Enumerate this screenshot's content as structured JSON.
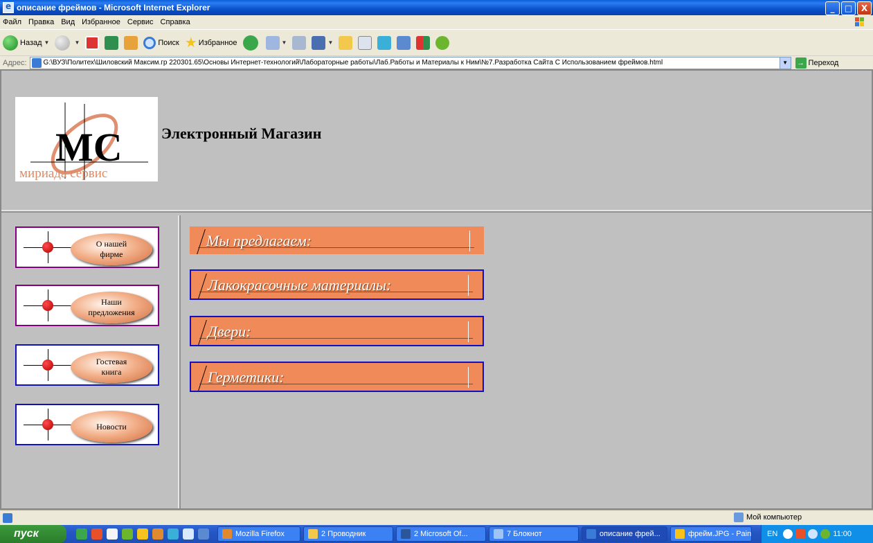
{
  "window": {
    "title": "описание фреймов - Microsoft Internet Explorer",
    "minimize": "_",
    "maximize": "□",
    "close": "X"
  },
  "menu": {
    "items": [
      "Файл",
      "Правка",
      "Вид",
      "Избранное",
      "Сервис",
      "Справка"
    ]
  },
  "toolbar": {
    "back_label": "Назад",
    "search_label": "Поиск",
    "favorites_label": "Избранное"
  },
  "address": {
    "label": "Адрес:",
    "value": "G:\\ВУЗ\\Политех\\Шиловский Максим.гр 220301.65\\Основы Интернет-технологий\\Лабораторные работы\\Лаб.Работы и Материалы к Ним\\№7.Разработка Сайта С Использованием фреймов.html",
    "go_label": "Переход"
  },
  "header": {
    "logo_letters": "МС",
    "logo_text": "мириада сервис",
    "title": "Электронный Магазин"
  },
  "nav": {
    "items": [
      {
        "line1": "О нашей",
        "line2": "фирме"
      },
      {
        "line1": "Наши",
        "line2": "предложения"
      },
      {
        "line1": "Гостевая",
        "line2": "книга"
      },
      {
        "line1": "Новости",
        "line2": ""
      }
    ]
  },
  "main": {
    "banners": [
      "Мы предлагаем:",
      "Лакокрасочные материалы:",
      "Двери:",
      "Герметики:"
    ]
  },
  "status": {
    "zone": "Мой компьютер"
  },
  "taskbar": {
    "start": "пуск",
    "tasks": [
      "Mozilla Firefox",
      "2 Проводник",
      "2 Microsoft Of...",
      "7 Блокнот",
      "описание фрей...",
      "фрейм.JPG - Paint"
    ],
    "lang": "EN",
    "time": "11:00"
  },
  "colors": {
    "frame_bg": "#c0c0c0",
    "banner": "#f08a58",
    "banner_border": "#1010c0",
    "nav_border_purple": "#800080",
    "nav_border_blue": "#1010c0"
  }
}
